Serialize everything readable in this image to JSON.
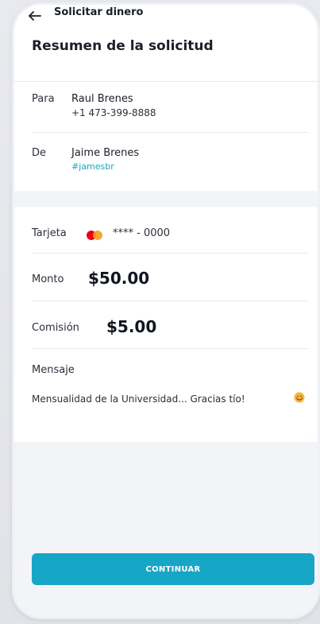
{
  "topbar": {
    "back_icon": "back-arrow-icon",
    "title": "Solicitar dinero"
  },
  "header": {
    "title": "Resumen de la solicitud"
  },
  "parties": {
    "to": {
      "label": "Para",
      "name": "Raul Brenes",
      "phone": "+1 473-399-8888"
    },
    "from": {
      "label": "De",
      "name": "Jaime Brenes",
      "handle": "#jamesbr"
    }
  },
  "details": {
    "card": {
      "label": "Tarjeta",
      "icon": "mastercard-icon",
      "masked": "**** - 0000"
    },
    "amount": {
      "label": "Monto",
      "value": "$50.00"
    },
    "fee": {
      "label": "Comisión",
      "value": "$5.00"
    },
    "message": {
      "label": "Mensaje",
      "text": "Mensualidad de la Universidad... Gracias tío!",
      "emoji_icon": "smiling-emoji-icon"
    }
  },
  "actions": {
    "continue_label": "CONTINUAR"
  },
  "colors": {
    "accent": "#18a6c6",
    "handle": "#17a7c4",
    "mc_red": "#eb001b",
    "mc_orange": "#f79e1b"
  }
}
